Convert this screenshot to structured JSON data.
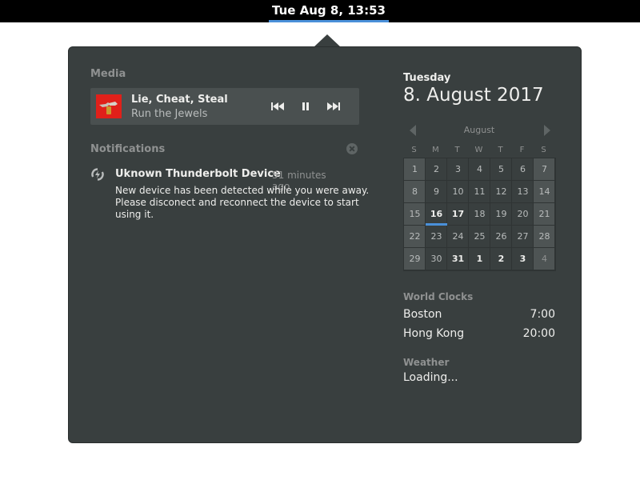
{
  "topbar": {
    "clock": "Tue Aug 8, 13:53"
  },
  "media": {
    "heading": "Media",
    "track_title": "Lie, Cheat, Steal",
    "artist": "Run the Jewels",
    "controls": [
      "previous-icon",
      "pause-icon",
      "next-icon"
    ]
  },
  "notifications": {
    "heading": "Notifications",
    "items": [
      {
        "icon": "thunderbolt-icon",
        "title": "Uknown Thunderbolt Device",
        "time": "51 minutes ago",
        "body_lines": [
          "New device has been detected while you were away.",
          "Please disconect and reconnect the device to start",
          "using it."
        ]
      }
    ]
  },
  "calendar": {
    "day_name": "Tuesday",
    "full_date": "8. August 2017",
    "month": "August",
    "weekdays": [
      "S",
      "M",
      "T",
      "W",
      "T",
      "F",
      "S"
    ],
    "days": [
      "30",
      "31",
      "1",
      "2",
      "3",
      "4",
      "5",
      "6",
      "7",
      "8",
      "9",
      "10",
      "11",
      "12",
      "13",
      "14",
      "15",
      "16",
      "17",
      "18",
      "19",
      "20",
      "21",
      "22",
      "23",
      "24",
      "25",
      "26",
      "27",
      "28",
      "29",
      "30",
      "31",
      "1",
      "2",
      "3",
      "4"
    ],
    "days_flat": [
      "1",
      "2",
      "3",
      "4",
      "5",
      "6",
      "7",
      "8",
      "9",
      "10",
      "11",
      "12",
      "13",
      "14",
      "15",
      "16",
      "17",
      "18",
      "19",
      "20",
      "21",
      "22",
      "23",
      "24",
      "25",
      "26",
      "27",
      "28",
      "29",
      "30",
      "31",
      "1",
      "2",
      "3",
      "4"
    ],
    "today": "16",
    "event_days": [
      "17",
      "31"
    ],
    "accent_color": "#4a90d9"
  },
  "world_clocks": {
    "heading": "World Clocks",
    "items": [
      {
        "city": "Boston",
        "time": "7:00"
      },
      {
        "city": "Hong Kong",
        "time": "20:00"
      }
    ]
  },
  "weather": {
    "heading": "Weather",
    "status": "Loading..."
  }
}
